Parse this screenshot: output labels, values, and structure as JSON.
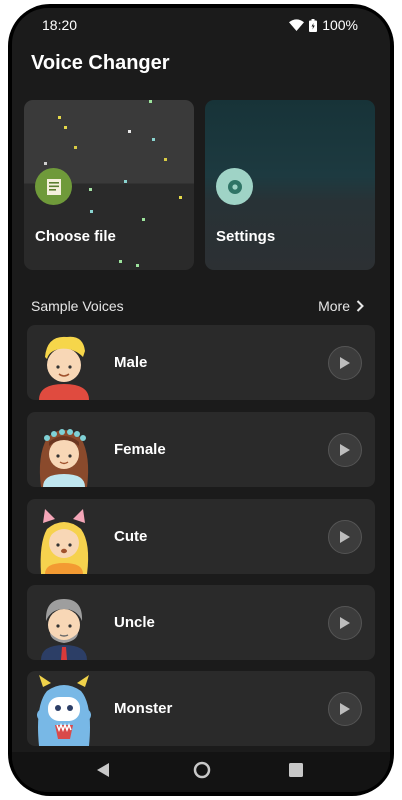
{
  "status_bar": {
    "time": "18:20",
    "battery": "100%"
  },
  "app": {
    "title": "Voice Changer"
  },
  "cards": {
    "choose_file": {
      "label": "Choose file",
      "icon": "file-icon",
      "color": "#6f9a3a"
    },
    "settings": {
      "label": "Settings",
      "icon": "gear-icon",
      "color": "#9fd3c6"
    }
  },
  "samples": {
    "header": "Sample Voices",
    "more": "More",
    "voices": [
      {
        "name": "Male"
      },
      {
        "name": "Female"
      },
      {
        "name": "Cute"
      },
      {
        "name": "Uncle"
      },
      {
        "name": "Monster"
      }
    ]
  },
  "navigation": {
    "back": "back-icon",
    "home": "home-icon",
    "recents": "recents-icon"
  }
}
